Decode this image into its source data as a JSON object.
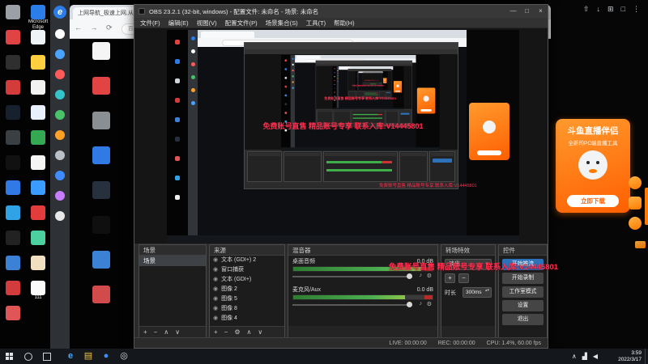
{
  "watermark": {
    "text": "免费账号直售 精品账号专享 联系入库:V14445801"
  },
  "browser": {
    "tab_title": "上网导航_极速上网,从这里开始",
    "new_tab_label": "+",
    "nav_icons": "← → ⟳",
    "address_text": "百度一下,你就知道"
  },
  "obs": {
    "title": "OBS 23.2.1 (32-bit, windows) - 配置文件: 未命名 - 场景: 未命名",
    "window_buttons": {
      "minimize": "—",
      "maximize": "□",
      "close": "×"
    },
    "menu_items": [
      {
        "label": "文件(F)"
      },
      {
        "label": "编辑(E)"
      },
      {
        "label": "视图(V)"
      },
      {
        "label": "配置文件(P)"
      },
      {
        "label": "场景集合(S)"
      },
      {
        "label": "工具(T)"
      },
      {
        "label": "帮助(H)"
      }
    ],
    "scenes_dock": {
      "title": "场景",
      "items": [
        {
          "label": "场景"
        }
      ]
    },
    "sources_dock": {
      "title": "来源",
      "items": [
        {
          "label": "文本 (GDI+) 2"
        },
        {
          "label": "窗口捕获"
        },
        {
          "label": "文本 (GDI+)"
        },
        {
          "label": "图像 2"
        },
        {
          "label": "图像 5"
        },
        {
          "label": "图像 8"
        },
        {
          "label": "图像 4"
        }
      ]
    },
    "mixer_dock": {
      "title": "混音器",
      "channels": [
        {
          "label": "桌面音频",
          "db": "0.0 dB",
          "fill": "92%"
        },
        {
          "label": "麦克风/Aux",
          "db": "0.0 dB",
          "fill": "80%"
        }
      ]
    },
    "transitions_dock": {
      "title": "转场特效",
      "selected": "淡出",
      "duration_label": "时长",
      "duration_value": "300ms"
    },
    "controls_dock": {
      "title": "控件",
      "buttons": [
        {
          "label": "开始推流",
          "class": "primary"
        },
        {
          "label": "开始录制"
        },
        {
          "label": "工作室模式"
        },
        {
          "label": "设置"
        },
        {
          "label": "退出"
        }
      ]
    },
    "status_bar": {
      "live": "LIVE: 00:00:00",
      "rec": "REC: 00:00:00",
      "cpu": "CPU: 1.4%, 60.00 fps"
    }
  },
  "douyu": {
    "title": "斗鱼直播伴侣",
    "subtitle": "全新的PC端直播工具",
    "download_label": "立即下载"
  },
  "taskbar": {
    "time": "3:59",
    "date": "2022/3/17"
  },
  "icons": {
    "eye": "◉",
    "add": "+",
    "remove": "−",
    "settings": "⚙",
    "up": "∧",
    "down": "∨",
    "combo_arrow": "▾",
    "spin_arrows": "▴▾",
    "speaker": "♪"
  },
  "desktop": {
    "column1": [
      {
        "color": "#9aa0a6",
        "label": ""
      },
      {
        "color": "#e04343",
        "label": ""
      },
      {
        "color": "#2f2f2f",
        "label": ""
      },
      {
        "color": "#d43b3b",
        "label": ""
      },
      {
        "color": "#17202d",
        "label": ""
      },
      {
        "color": "#3a3f44",
        "label": ""
      },
      {
        "color": "#111111",
        "label": ""
      },
      {
        "color": "#2f7ae5",
        "label": ""
      },
      {
        "color": "#2fa3e5",
        "label": ""
      },
      {
        "color": "#222222",
        "label": ""
      },
      {
        "color": "#3b82d6",
        "label": ""
      },
      {
        "color": "#d23c3c",
        "label": ""
      },
      {
        "color": "#e05555",
        "label": ""
      }
    ],
    "column2": [
      {
        "color": "#2b7de9",
        "label": "Microsoft Edge"
      },
      {
        "color": "#eef3f8",
        "label": ""
      },
      {
        "color": "#ffcf40",
        "label": ""
      },
      {
        "color": "#f2f2f2",
        "label": ""
      },
      {
        "color": "#e8f0fe",
        "label": ""
      },
      {
        "color": "#34a853",
        "label": ""
      },
      {
        "color": "#f5f5f5",
        "label": ""
      },
      {
        "color": "#3b9cff",
        "label": ""
      },
      {
        "color": "#e23c3c",
        "label": ""
      },
      {
        "color": "#4cd0a0",
        "label": ""
      },
      {
        "color": "#f0e0c0",
        "label": ""
      },
      {
        "color": "#fafafa",
        "label": "111"
      }
    ],
    "column3": [
      {
        "color": "#f5f5f5",
        "label": ""
      },
      {
        "color": "#e24444",
        "label": ""
      },
      {
        "color": "#8a8f94",
        "label": ""
      },
      {
        "color": "#2f7ae5",
        "label": ""
      },
      {
        "color": "#26313d",
        "label": ""
      },
      {
        "color": "#0f0f0f",
        "label": ""
      },
      {
        "color": "#3b82d6",
        "label": ""
      },
      {
        "color": "#d24b4b",
        "label": ""
      }
    ],
    "sidebar_shortcuts": [
      {
        "color": "#ffffff"
      },
      {
        "color": "#4aa3ff"
      },
      {
        "color": "#ff5b5b"
      },
      {
        "color": "#35c2c9"
      },
      {
        "color": "#49c26a"
      },
      {
        "color": "#ffa126"
      },
      {
        "color": "#b9c0c7"
      },
      {
        "color": "#3f8cff"
      },
      {
        "color": "#c77dff"
      },
      {
        "color": "#e8e8e8"
      }
    ]
  },
  "right_panel": {
    "top_icons": [
      {
        "glyph": "⇧",
        "name": "share-icon"
      },
      {
        "glyph": "↓",
        "name": "download-icon"
      },
      {
        "glyph": "⊞",
        "name": "apps-icon"
      },
      {
        "glyph": "□",
        "name": "window-icon"
      },
      {
        "glyph": "⋮",
        "name": "more-icon"
      }
    ]
  },
  "taskbar_apps": [
    {
      "glyph": "e",
      "color": "#44a7ff",
      "name": "taskbar-edge-icon"
    },
    {
      "glyph": "▤",
      "color": "#f6c445",
      "name": "taskbar-explorer-icon"
    },
    {
      "glyph": "●",
      "color": "#3f8ef7",
      "name": "taskbar-browser-icon"
    },
    {
      "glyph": "◎",
      "color": "#d7dbdf",
      "name": "taskbar-obs-icon"
    }
  ],
  "tray_icons": [
    {
      "glyph": "∧",
      "name": "tray-expand-icon"
    },
    {
      "glyph": "▟",
      "name": "network-icon"
    },
    {
      "glyph": "◀",
      "name": "volume-icon"
    }
  ]
}
